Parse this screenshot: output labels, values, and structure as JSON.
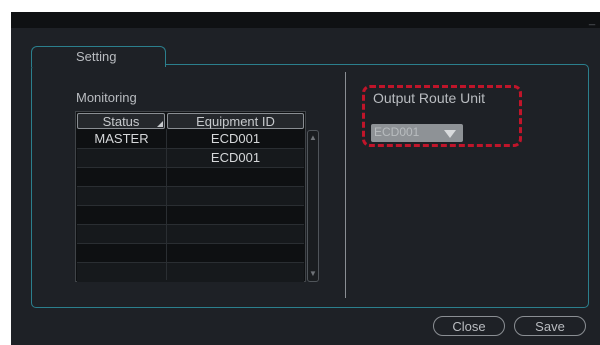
{
  "window": {
    "minimize_glyph": "_"
  },
  "tab": {
    "label": "Setting"
  },
  "monitoring": {
    "label": "Monitoring",
    "columns": [
      "Status",
      "Equipment ID"
    ],
    "rows": [
      [
        "MASTER",
        "ECD001"
      ],
      [
        "",
        "ECD001"
      ],
      [
        "",
        ""
      ],
      [
        "",
        ""
      ],
      [
        "",
        ""
      ],
      [
        "",
        ""
      ],
      [
        "",
        ""
      ],
      [
        "",
        ""
      ]
    ]
  },
  "output_route": {
    "label": "Output Route Unit",
    "selected": "ECD001"
  },
  "buttons": {
    "close": "Close",
    "save": "Save"
  },
  "icons": [
    "minimize-icon",
    "sort-indicator-icon",
    "scroll-up-icon",
    "scroll-down-icon",
    "dropdown-arrow-icon"
  ],
  "colors": {
    "accent_border": "#2b7f8d",
    "highlight": "#c0152a",
    "background": "#1e2126"
  }
}
